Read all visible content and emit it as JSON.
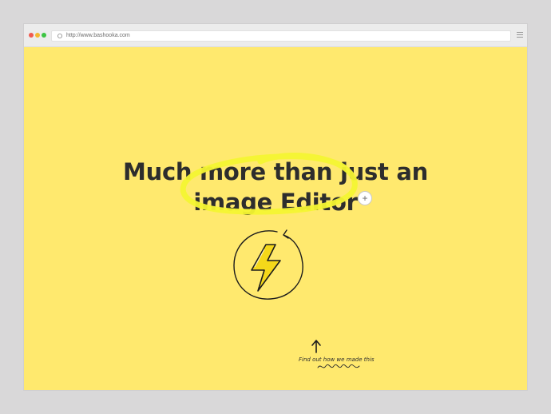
{
  "browser": {
    "url": "http://www.bashooka.com"
  },
  "hero": {
    "headline_line1": "Much more than just an",
    "headline_line2": "image Editor",
    "plus_label": "+"
  },
  "note": {
    "text": "Find out how we made this"
  },
  "colors": {
    "background": "#ffe96e",
    "highlight": "#f4f532",
    "text": "#2d2d2d"
  },
  "icons": [
    "reload-icon",
    "menu-icon",
    "plus-icon",
    "lightning-bolt-icon",
    "arrow-up-icon"
  ]
}
